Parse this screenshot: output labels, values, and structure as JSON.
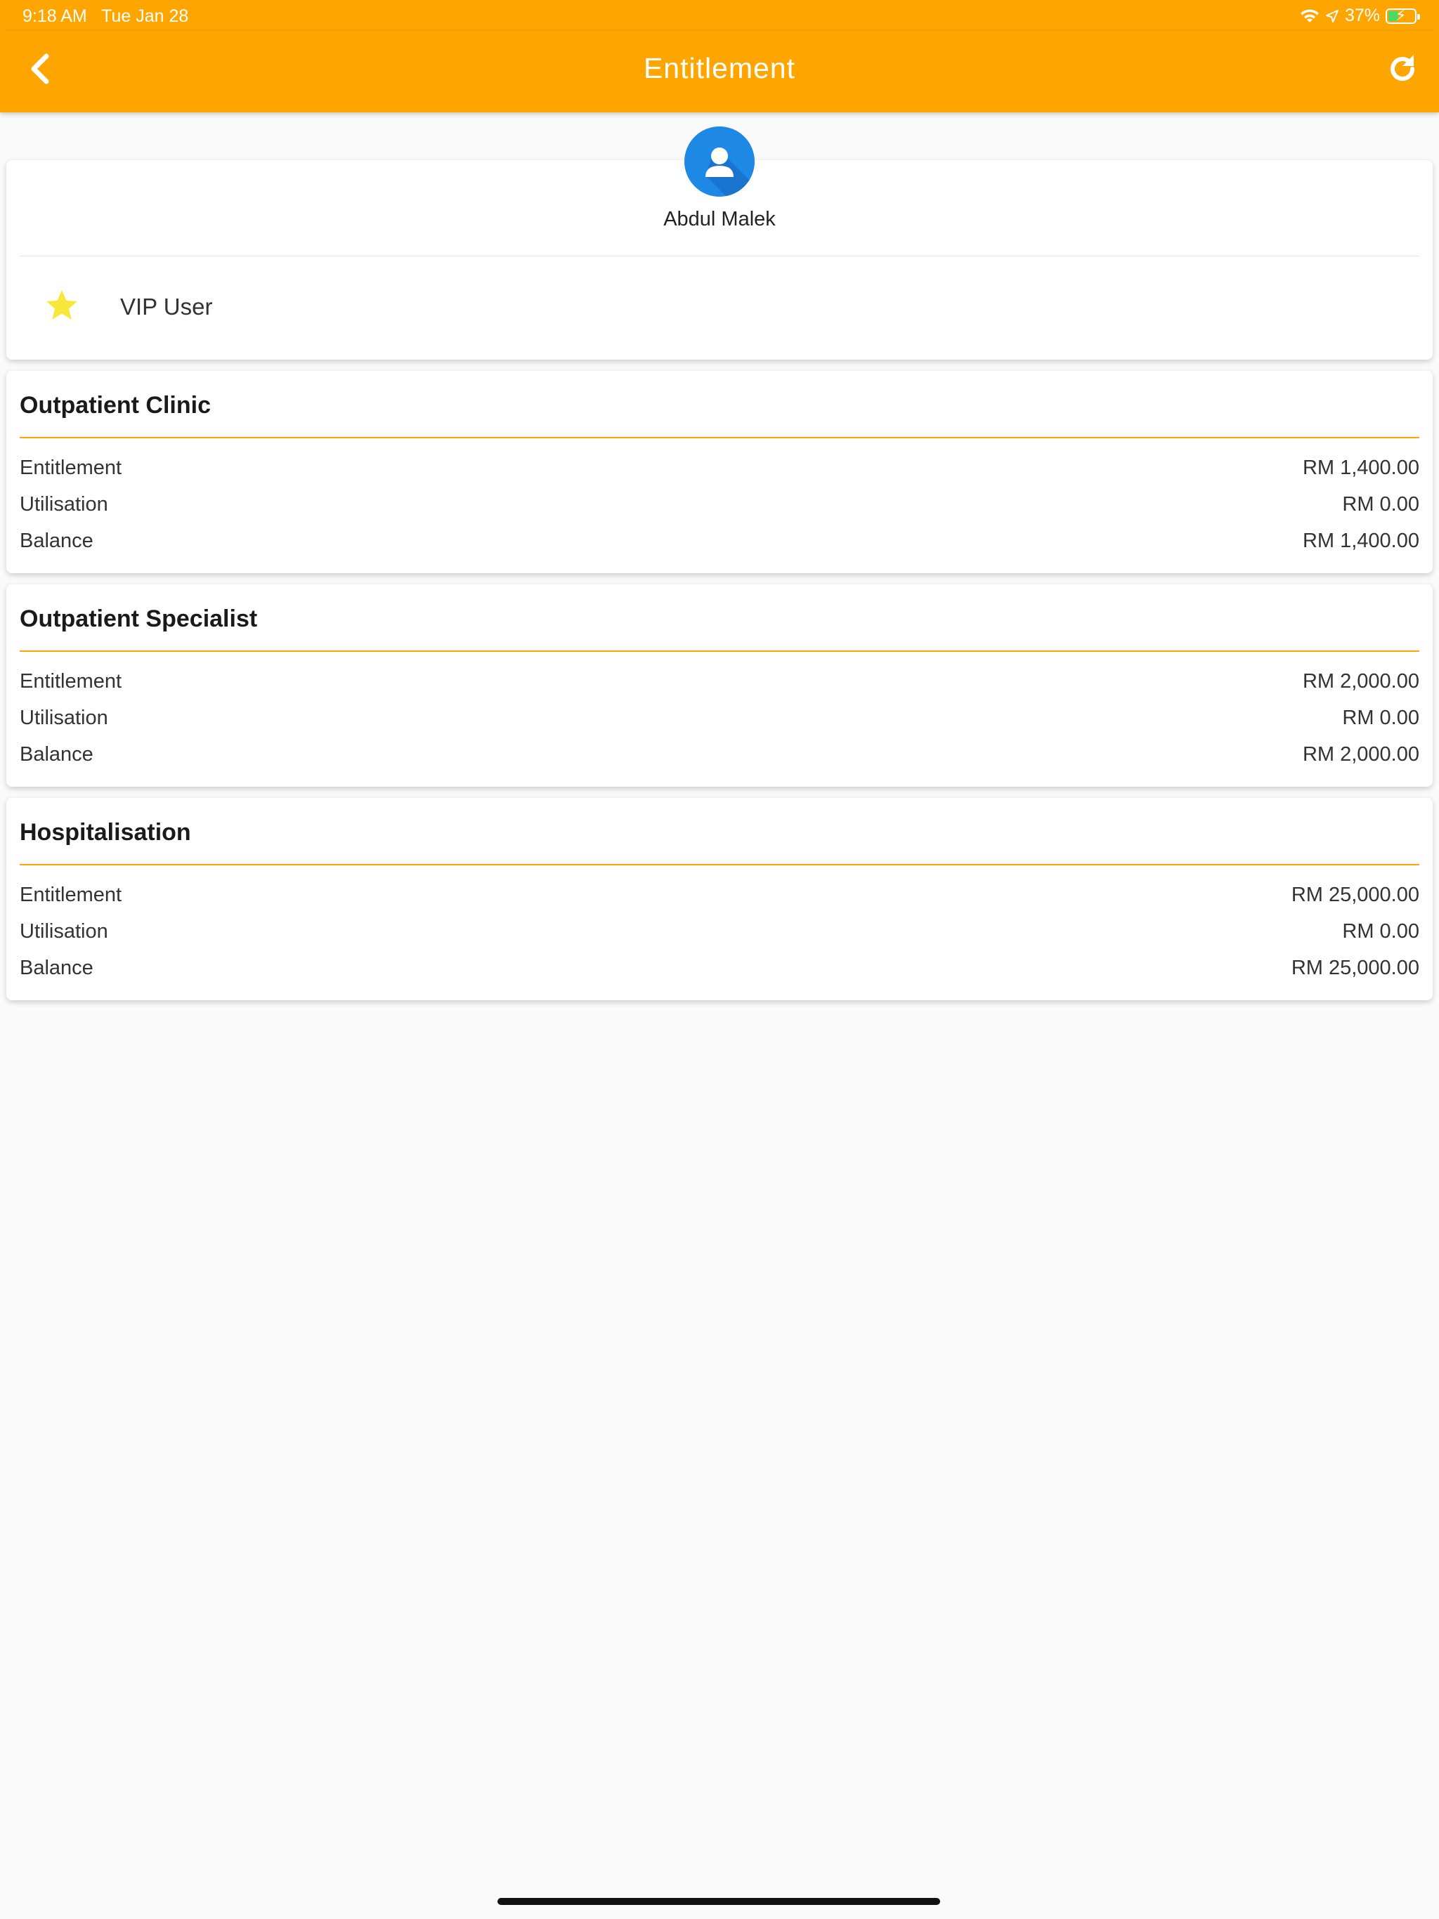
{
  "status_bar": {
    "time": "9:18 AM",
    "date": "Tue Jan 28",
    "battery_percent": "37%",
    "battery_level": 0.37
  },
  "header": {
    "title": "Entitlement",
    "back_icon": "chevron-left-icon",
    "refresh_icon": "refresh-icon"
  },
  "profile": {
    "name": "Abdul Malek",
    "tier_label": "VIP User",
    "avatar_icon": "user-icon",
    "tier_icon": "star-icon"
  },
  "colors": {
    "accent": "#ffa500",
    "avatar": "#1e88e5",
    "star": "#f9e73a"
  },
  "sections": [
    {
      "title": "Outpatient Clinic",
      "rows": [
        {
          "label": "Entitlement",
          "value": "RM 1,400.00"
        },
        {
          "label": "Utilisation",
          "value": "RM 0.00"
        },
        {
          "label": "Balance",
          "value": "RM 1,400.00"
        }
      ]
    },
    {
      "title": "Outpatient Specialist",
      "rows": [
        {
          "label": "Entitlement",
          "value": "RM 2,000.00"
        },
        {
          "label": "Utilisation",
          "value": "RM 0.00"
        },
        {
          "label": "Balance",
          "value": "RM 2,000.00"
        }
      ]
    },
    {
      "title": "Hospitalisation",
      "rows": [
        {
          "label": "Entitlement",
          "value": "RM 25,000.00"
        },
        {
          "label": "Utilisation",
          "value": "RM 0.00"
        },
        {
          "label": "Balance",
          "value": "RM 25,000.00"
        }
      ]
    }
  ]
}
